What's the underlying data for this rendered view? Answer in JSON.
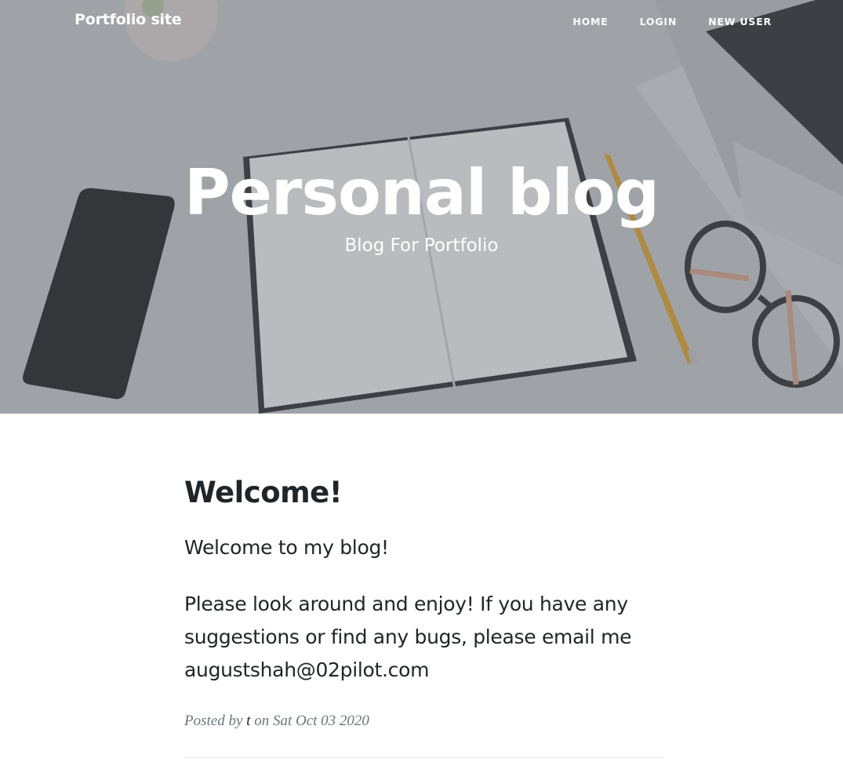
{
  "navbar": {
    "brand": "Portfolio site",
    "links": [
      "HOME",
      "LOGIN",
      "NEW USER"
    ]
  },
  "hero": {
    "title": "Personal blog",
    "subtitle": "Blog For Portfolio"
  },
  "post": {
    "title": "Welcome!",
    "paragraphs": [
      "Welcome to my blog!",
      "Please look around and enjoy! If you have any suggestions or find any bugs, please email me augustshah@02pilot.com"
    ],
    "meta": {
      "posted_by_label": "Posted by",
      "author": "t",
      "on_label": "on",
      "date": "Sat Oct 03 2020"
    }
  }
}
